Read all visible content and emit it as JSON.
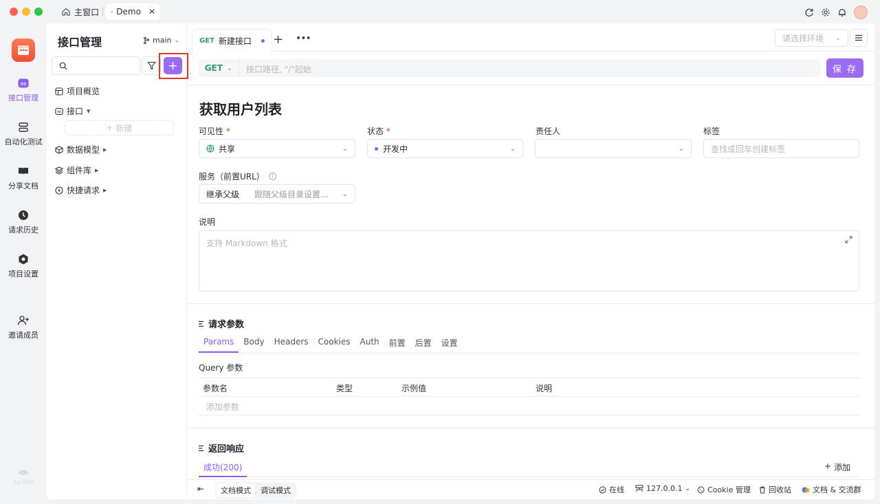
{
  "window": {
    "tabs": [
      {
        "label": "主窗口"
      },
      {
        "label": "Demo"
      }
    ]
  },
  "leftnav": {
    "items": [
      {
        "label": "接口管理",
        "icon": "api-icon",
        "active": true
      },
      {
        "label": "自动化测试",
        "icon": "stack-icon"
      },
      {
        "label": "分享文档",
        "icon": "book-icon"
      },
      {
        "label": "请求历史",
        "icon": "clock-icon"
      },
      {
        "label": "项目设置",
        "icon": "hexagon-icon"
      },
      {
        "label": "邀请成员",
        "icon": "user-plus-icon"
      }
    ],
    "footer_logo": "Apifox"
  },
  "tree": {
    "title": "接口管理",
    "branch": "main",
    "add_label": "+",
    "items": [
      {
        "label": "项目概览",
        "icon": "overview-icon"
      },
      {
        "label": "接口",
        "icon": "api-small-icon"
      },
      {
        "label": "数据模型",
        "icon": "cube-icon"
      },
      {
        "label": "组件库",
        "icon": "layers-icon"
      },
      {
        "label": "快捷请求",
        "icon": "bolt-icon"
      }
    ],
    "new_label": "新建"
  },
  "editor": {
    "tab": {
      "method": "GET",
      "title": "新建接口"
    },
    "env_placeholder": "请选择环境",
    "method": "GET",
    "url_placeholder": "接口路径, \"/\"起始",
    "save_label": "保 存",
    "page_title": "获取用户列表",
    "fields": {
      "visibility": {
        "label": "可见性",
        "value": "共享"
      },
      "status": {
        "label": "状态",
        "value": "开发中"
      },
      "owner": {
        "label": "责任人",
        "value": ""
      },
      "tags": {
        "label": "标签",
        "placeholder": "查找或回车创建标签"
      },
      "service": {
        "label": "服务（前置URL）",
        "value": "继承父级",
        "hint": "跟随父级目录设置..."
      },
      "description": {
        "label": "说明",
        "placeholder": "支持 Markdown 格式"
      }
    },
    "request_params": {
      "title": "请求参数",
      "tabs": [
        "Params",
        "Body",
        "Headers",
        "Cookies",
        "Auth",
        "前置",
        "后置",
        "设置"
      ],
      "query_label": "Query 参数",
      "columns": [
        "参数名",
        "类型",
        "示例值",
        "说明"
      ],
      "add_param": "添加参数"
    },
    "response": {
      "title": "返回响应",
      "tab": "成功(200)",
      "add_label": "添加"
    }
  },
  "statusbar": {
    "modes": [
      "文档模式",
      "调试模式"
    ],
    "online": "在线",
    "ip": "127.0.0.1",
    "cookie": "Cookie 管理",
    "recycle": "回收站",
    "docs": "文档 & 交流群"
  },
  "colors": {
    "accent": "#9b6cf3",
    "get": "#2f9e6b",
    "highlight": "#e3342f"
  }
}
